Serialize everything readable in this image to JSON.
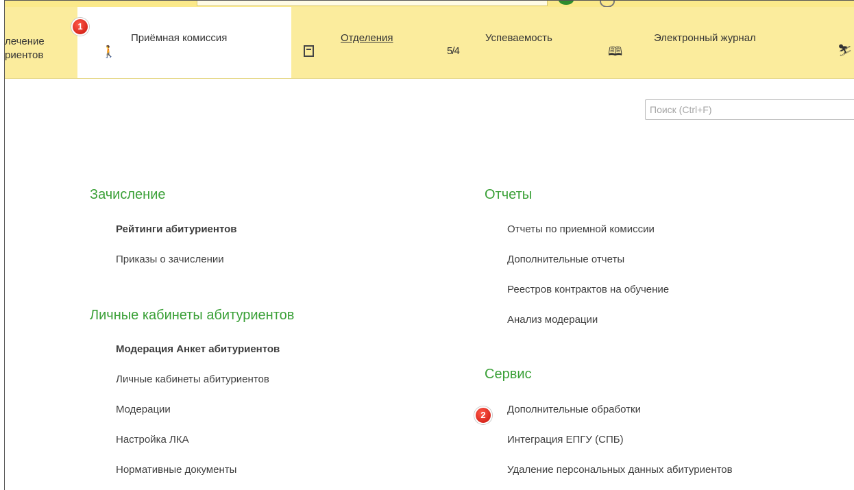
{
  "nav": {
    "partial_line1": "лечение",
    "partial_line2": "риентов",
    "admissions": "Приёмная комиссия",
    "departments": "Отделения",
    "performance_icon_text": "5/4",
    "performance": "Успеваемость",
    "journal": "Электронный журнал"
  },
  "badges": {
    "first": "1",
    "second": "2"
  },
  "search": {
    "placeholder": "Поиск (Ctrl+F)"
  },
  "sections": {
    "enrollment": {
      "title": "Зачисление",
      "items": [
        "Рейтинги абитуриентов",
        "Приказы о зачислении"
      ]
    },
    "cabinets": {
      "title": "Личные кабинеты абитуриентов",
      "items": [
        "Модерация Анкет абитуриентов",
        "Личные кабинеты абитуриентов",
        "Модерации",
        "Настройка ЛКА",
        "Нормативные документы"
      ]
    },
    "reports": {
      "title": "Отчеты",
      "items": [
        "Отчеты по приемной комиссии",
        "Дополнительные отчеты",
        "Реестров контрактов на обучение",
        "Анализ модерации"
      ]
    },
    "service": {
      "title": "Сервис",
      "items": [
        "Дополнительные обработки",
        "Интеграция ЕПГУ (СПБ)",
        "Удаление персональных данных абитуриентов"
      ]
    }
  },
  "colors": {
    "accent_green": "#3aa037",
    "nav_bg": "#fbec9d",
    "badge_red": "#d9261c"
  }
}
